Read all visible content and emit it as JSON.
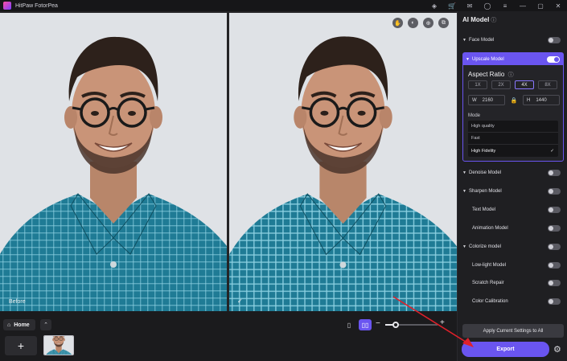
{
  "app": {
    "title": "HitPaw FotorPea"
  },
  "titlebar_icons": [
    {
      "name": "discord-icon",
      "glyph": "◈"
    },
    {
      "name": "cart-icon",
      "glyph": "🛒"
    },
    {
      "name": "mail-icon",
      "glyph": "✉"
    },
    {
      "name": "account-icon",
      "glyph": "◯"
    },
    {
      "name": "menu-icon",
      "glyph": "≡"
    },
    {
      "name": "minimize-icon",
      "glyph": "—"
    },
    {
      "name": "maximize-icon",
      "glyph": "▢"
    },
    {
      "name": "close-icon",
      "glyph": "✕"
    }
  ],
  "canvas": {
    "before_label": "Before",
    "check_glyph": "✓",
    "tools": [
      {
        "name": "hand-tool-icon",
        "glyph": "✋"
      },
      {
        "name": "compare-tool-icon",
        "glyph": "◐"
      },
      {
        "name": "zoom-tool-icon",
        "glyph": "⊕"
      },
      {
        "name": "crop-tool-icon",
        "glyph": "⧉"
      }
    ]
  },
  "bottom": {
    "home_label": "Home",
    "home_glyph": "⌂",
    "expand_glyph": "⌃",
    "add_glyph": "+",
    "single_view_glyph": "▯",
    "split_view_glyph": "▯▯",
    "zoom_minus": "−",
    "zoom_plus": "+",
    "zoom_level": 0.2
  },
  "panel": {
    "title": "AI Model",
    "info_glyph": "ⓘ",
    "models_top": [
      {
        "label": "Face Model",
        "caret": "▼",
        "on": false
      }
    ],
    "upscale": {
      "label": "Upscale Model",
      "caret": "▼",
      "on": true,
      "aspect_ratio_title": "Aspect Ratio",
      "ratios": [
        {
          "label": "1X",
          "selected": false
        },
        {
          "label": "2X",
          "selected": false
        },
        {
          "label": "4X",
          "selected": true
        },
        {
          "label": "8X",
          "selected": false
        }
      ],
      "width_label": "W",
      "width_value": "2160",
      "height_label": "H",
      "height_value": "1440",
      "lock_glyph": "🔒",
      "mode_label": "Mode",
      "modes": [
        {
          "label": "High quality",
          "selected": false
        },
        {
          "label": "Fast",
          "selected": false
        },
        {
          "label": "High Fidelity",
          "selected": true
        }
      ],
      "selected_glyph": "✓"
    },
    "models_bottom": [
      {
        "label": "Denoise Model",
        "caret": "▼",
        "sub": false,
        "on": false
      },
      {
        "label": "Sharpen Model",
        "caret": "▼",
        "sub": false,
        "on": false
      },
      {
        "label": "Text Model",
        "caret": "",
        "sub": true,
        "on": false
      },
      {
        "label": "Animation Model",
        "caret": "",
        "sub": true,
        "on": false
      },
      {
        "label": "Colorize model",
        "caret": "▼",
        "sub": false,
        "on": false
      },
      {
        "label": "Low-light Model",
        "caret": "",
        "sub": true,
        "on": false
      },
      {
        "label": "Scratch Repair",
        "caret": "",
        "sub": true,
        "on": false
      },
      {
        "label": "Color Calibration",
        "caret": "",
        "sub": true,
        "on": false
      }
    ],
    "apply_label": "Apply Current Settings to All",
    "export_label": "Export",
    "settings_glyph": "⚙"
  },
  "colors": {
    "accent": "#6a55f0",
    "shirt": "#1f7b95",
    "annotation_arrow": "#e0202a"
  }
}
